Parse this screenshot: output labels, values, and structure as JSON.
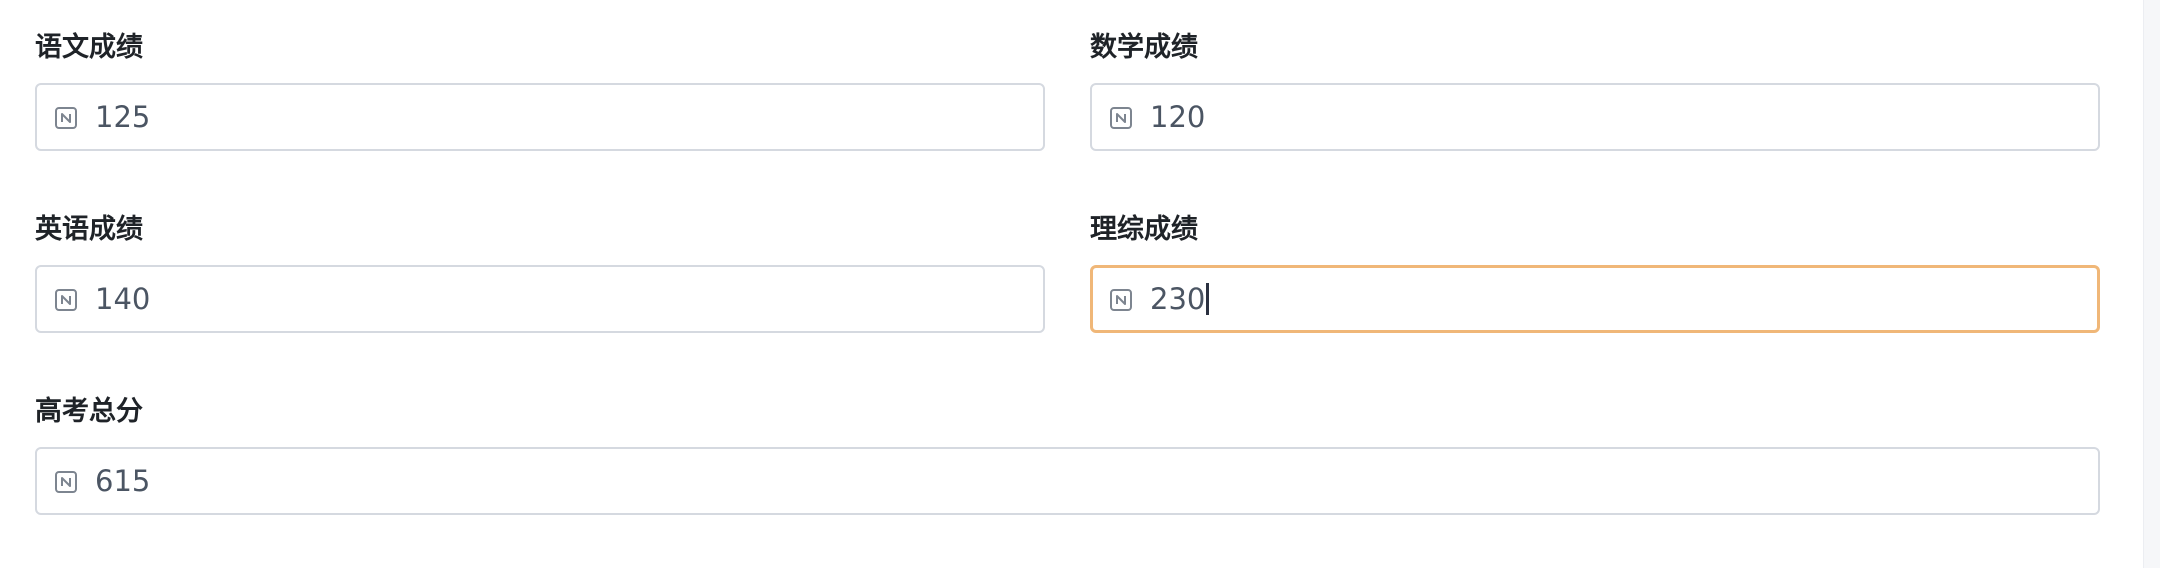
{
  "form": {
    "fields": [
      {
        "label": "语文成绩",
        "value": "125",
        "focused": false
      },
      {
        "label": "数学成绩",
        "value": "120",
        "focused": false
      },
      {
        "label": "英语成绩",
        "value": "140",
        "focused": false
      },
      {
        "label": "理综成绩",
        "value": "230",
        "focused": true
      },
      {
        "label": "高考总分",
        "value": "615",
        "focused": false
      }
    ]
  },
  "icons": {
    "number_field": "number-type-icon"
  },
  "colors": {
    "focus_border": "#f0b778",
    "default_border": "#d5d9e0",
    "label_text": "#1f2328",
    "value_text": "#4b5563"
  }
}
